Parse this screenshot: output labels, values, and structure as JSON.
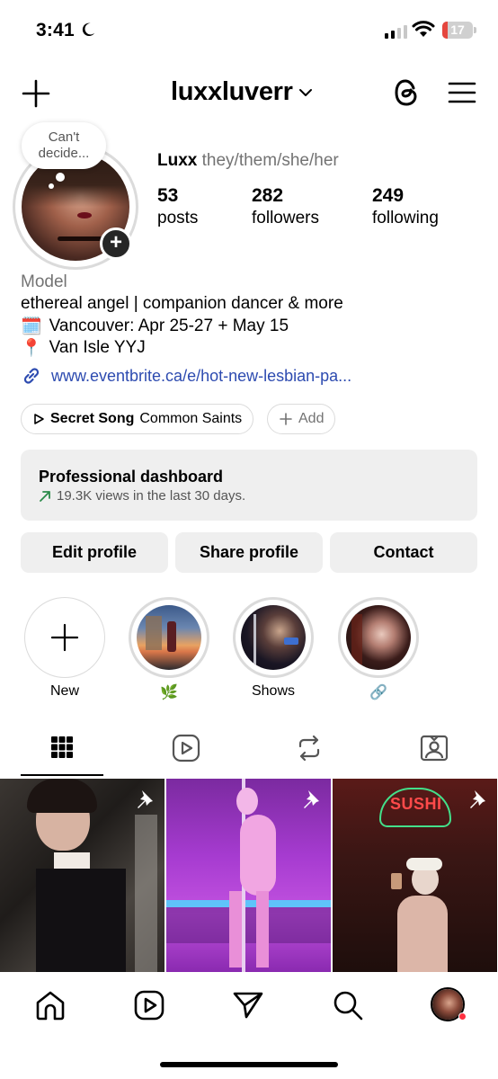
{
  "status_bar": {
    "time": "3:41",
    "battery": "17",
    "battery_level": 0.17,
    "battery_color": "#e5463e"
  },
  "header": {
    "username": "luxxluverr",
    "icons": [
      "plus-icon",
      "chevron-down-icon",
      "threads-icon",
      "menu-icon"
    ]
  },
  "profile": {
    "note": "Can't decide...",
    "display_name": "Luxx",
    "pronouns": "they/them/she/her",
    "stats": [
      {
        "value": "53",
        "label": "posts"
      },
      {
        "value": "282",
        "label": "followers"
      },
      {
        "value": "249",
        "label": "following"
      }
    ],
    "category": "Model",
    "bio": [
      {
        "icon": "",
        "text": "ethereal angel | companion dancer & more"
      },
      {
        "icon": "🗓️",
        "text": "Vancouver: Apr 25-27 + May 15"
      },
      {
        "icon": "📍",
        "text": "Van Isle YYJ"
      }
    ],
    "link": "www.eventbrite.ca/e/hot-new-lesbian-pa...",
    "link_color": "#2d4bb0"
  },
  "music": {
    "song": "Secret Song",
    "artist": "Common Saints",
    "add_label": "Add"
  },
  "dashboard": {
    "title": "Professional dashboard",
    "subtitle": "19.3K views in the last 30 days.",
    "trend_color": "#2a8a4a"
  },
  "buttons": {
    "edit": "Edit profile",
    "share": "Share profile",
    "contact": "Contact"
  },
  "highlights": [
    {
      "label": "New"
    },
    {
      "label": "🌿"
    },
    {
      "label": "Shows"
    },
    {
      "label": "🔗"
    }
  ],
  "tabs": [
    "grid-icon",
    "reels-icon",
    "reposts-icon",
    "tagged-icon"
  ],
  "grid": [
    {
      "pinned": true
    },
    {
      "pinned": true,
      "overlay_text": ""
    },
    {
      "pinned": true,
      "sign_text": "SUSHI"
    }
  ],
  "bottom_nav": [
    "home-icon",
    "reels-icon",
    "messages-icon",
    "search-icon",
    "profile-avatar"
  ]
}
